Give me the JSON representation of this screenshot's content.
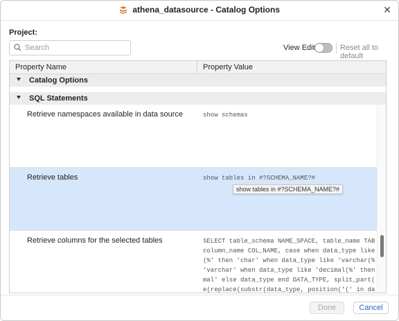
{
  "window": {
    "title": "athena_datasource - Catalog Options",
    "icon": "datasource-stack-icon",
    "accent": "#e07a2e"
  },
  "project": {
    "label": "Project:"
  },
  "search": {
    "placeholder": "Search",
    "value": ""
  },
  "view_edits": {
    "label": "View Edits",
    "enabled": false
  },
  "reset": {
    "label": "Reset all to default"
  },
  "table": {
    "columns": [
      "Property Name",
      "Property Value"
    ],
    "groups": [
      {
        "label": "Catalog Options",
        "expanded": true
      },
      {
        "label": "SQL Statements",
        "expanded": true
      }
    ],
    "rows": [
      {
        "name": "Retrieve namespaces available in data source",
        "value": "show schemas",
        "selected": false
      },
      {
        "name": "Retrieve tables",
        "value": "show tables in #?SCHEMA_NAME?#",
        "selected": true
      },
      {
        "name": "Retrieve columns for the selected tables",
        "value": "SELECT table_schema NAME_SPACE, table_name TAB_NAME,\ncolumn_name COL_NAME, case when data_type like 'char\n(%' then 'char' when data_type like 'varchar(%' then\n'varchar' when data_type like 'decimal(%' then 'deci\nmal' else data_type end DATA_TYPE, split_part(replac\ne(replace(substr(data_type, position('(' in data_typ",
        "selected": false
      }
    ],
    "tooltip": "show tables in #?SCHEMA_NAME?#"
  },
  "footer": {
    "done_label": "Done",
    "cancel_label": "Cancel"
  },
  "colors": {
    "selected_row": "#d6e6fb",
    "link_blue": "#1a66c9",
    "header_bg": "#f2f2f2"
  }
}
